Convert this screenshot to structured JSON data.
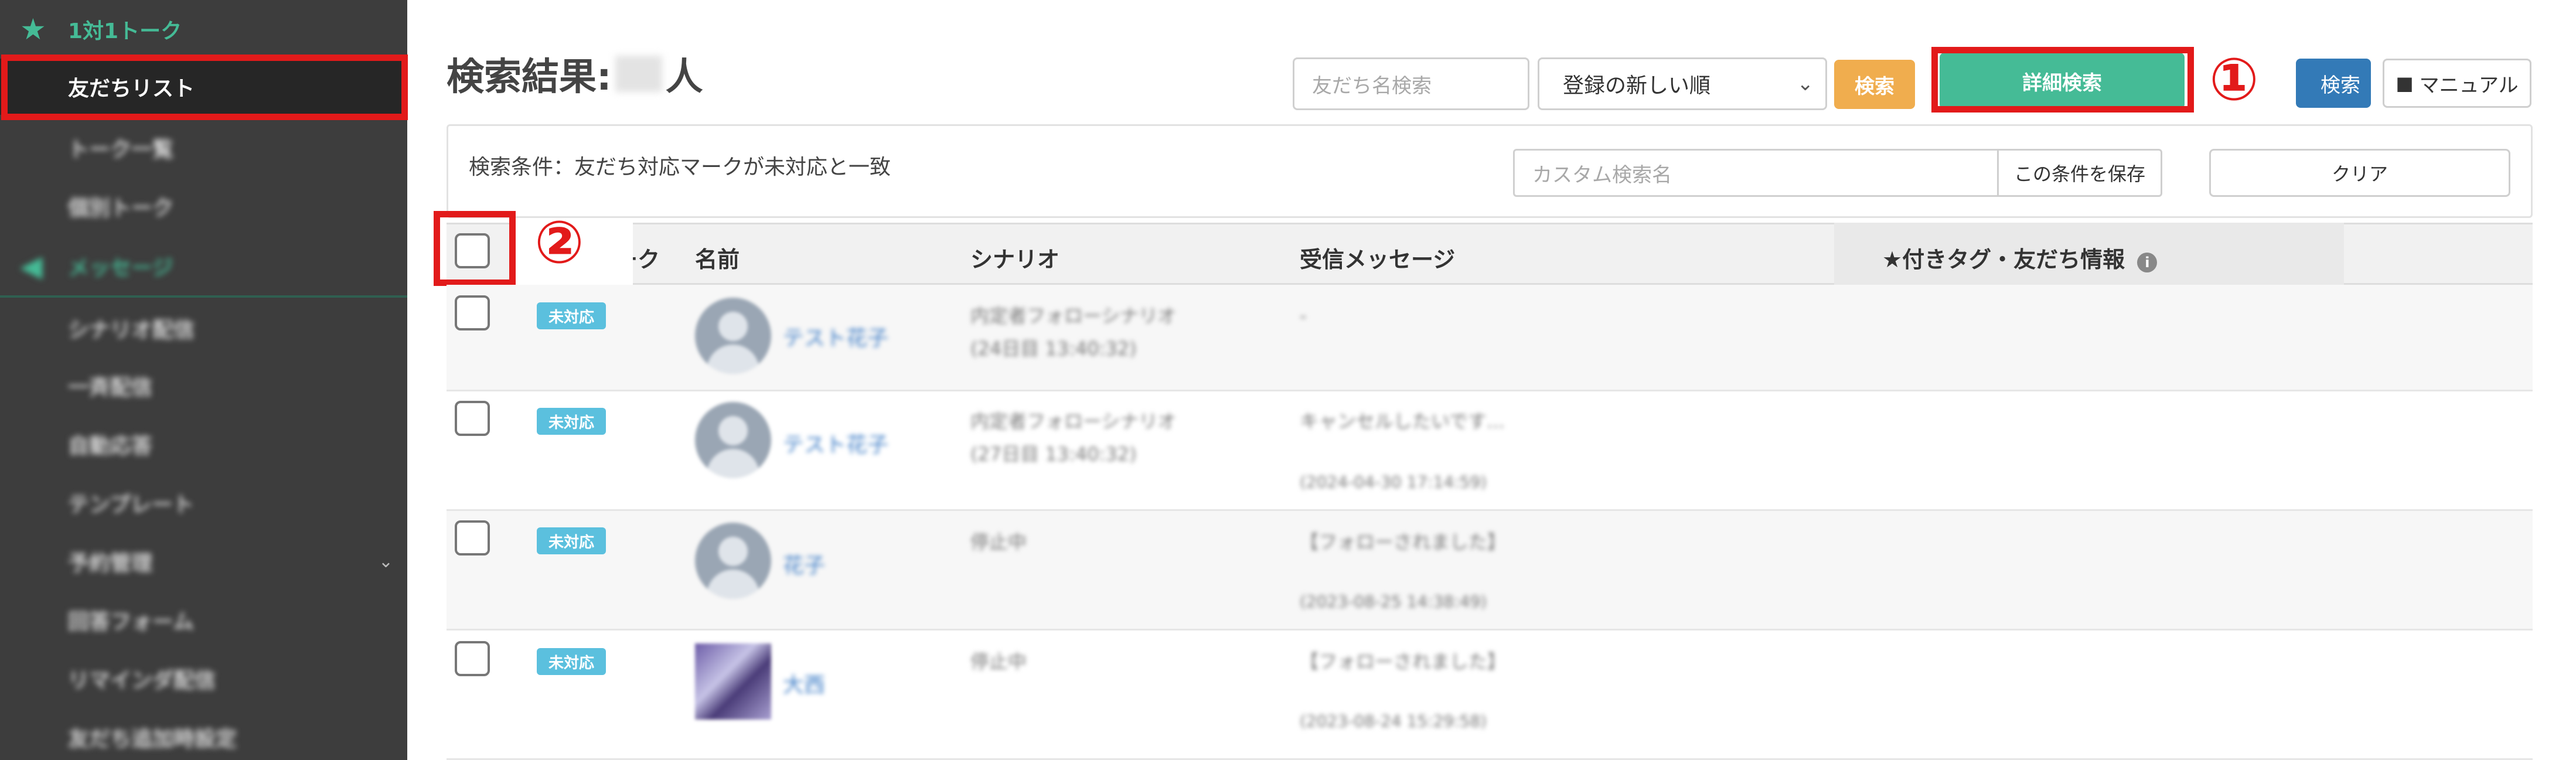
{
  "sidebar": {
    "section_talk": "1対1トーク",
    "items": [
      {
        "label": "友だちリスト"
      },
      {
        "label": "トーク一覧"
      },
      {
        "label": "個別トーク"
      }
    ],
    "section_message": "メッセージ",
    "message_items": [
      {
        "label": "シナリオ配信"
      },
      {
        "label": "一斉配信"
      },
      {
        "label": "自動応答"
      },
      {
        "label": "テンプレート"
      },
      {
        "label": "予約管理"
      },
      {
        "label": "回答フォーム"
      },
      {
        "label": "リマインダ配信"
      },
      {
        "label": "友だち追加時設定"
      }
    ]
  },
  "header": {
    "title": "検索結果:",
    "title_suffix": "人",
    "search_placeholder": "友だち名検索",
    "sort_value": "登録の新しい順",
    "search_button": "検索",
    "detail_search_button": "詳細検索",
    "blue_button": "検索",
    "manual_button": "マニュアル"
  },
  "annotations": {
    "one": "①",
    "two": "②"
  },
  "conditions": {
    "text": "検索条件：友だち対応マークが未対応と一致",
    "custom_search_placeholder": "カスタム検索名",
    "save_button": "この条件を保存",
    "clear_button": "クリア"
  },
  "table": {
    "headers": {
      "mark": "マーク",
      "name": "名前",
      "scenario": "シナリオ",
      "message": "受信メッセージ",
      "tags": "★付きタグ・友だち情報"
    },
    "rows": [
      {
        "badge": "未対応",
        "name": "テスト花子",
        "scenario": "内定者フォローシナリオ",
        "scenario_sub": "(24日目 13:40:32)",
        "message": "-",
        "message_date": ""
      },
      {
        "badge": "未対応",
        "name": "テスト花子",
        "scenario": "内定者フォローシナリオ",
        "scenario_sub": "(27日目 13:40:32)",
        "message": "キャンセルしたいです...",
        "message_date": "(2024-04-30 17:14:59)"
      },
      {
        "badge": "未対応",
        "name": "花子",
        "scenario": "停止中",
        "scenario_sub": "",
        "message": "【フォローされました】",
        "message_date": "(2023-08-25 14:38:49)"
      },
      {
        "badge": "未対応",
        "name": "大西",
        "scenario": "停止中",
        "scenario_sub": "",
        "message": "【フォローされました】",
        "message_date": "(2023-08-24 15:29:58)"
      }
    ]
  },
  "colors": {
    "accent_green": "#45bb96",
    "annotation_red": "#e21a1a",
    "badge_blue": "#5bc0de",
    "search_orange": "#f0ad4e"
  }
}
